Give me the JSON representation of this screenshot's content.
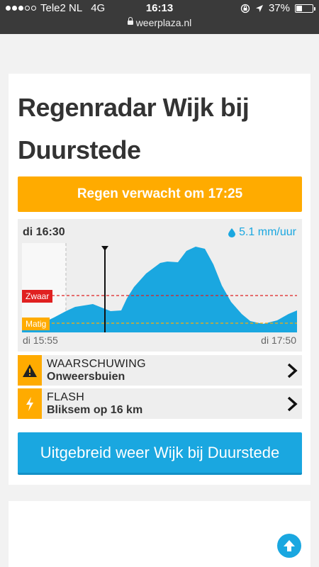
{
  "statusbar": {
    "carrier": "Tele2 NL",
    "network": "4G",
    "time": "16:13",
    "battery_percent": "37%",
    "battery_level": 0.37,
    "url": "weerplaza.nl"
  },
  "page": {
    "title": "Regenradar Wijk bij Duurstede"
  },
  "banner": {
    "label": "Regen verwacht om 17:25",
    "color": "#ffab00"
  },
  "radar": {
    "current_time": "di 16:30",
    "rate": "5.1 mm/uur",
    "start_time": "di 15:55",
    "end_time": "di 17:50",
    "level_zwaar": "Zwaar",
    "level_matig": "Matig",
    "accent": "#1aa7e0"
  },
  "alerts": [
    {
      "title": "WAARSCHUWING",
      "subtitle": "Onweersbuien",
      "icon": "warning-icon"
    },
    {
      "title": "FLASH",
      "subtitle": "Bliksem op 16 km",
      "icon": "lightning-icon"
    }
  ],
  "cta": {
    "label": "Uitgebreid weer Wijk bij Duurstede"
  }
}
